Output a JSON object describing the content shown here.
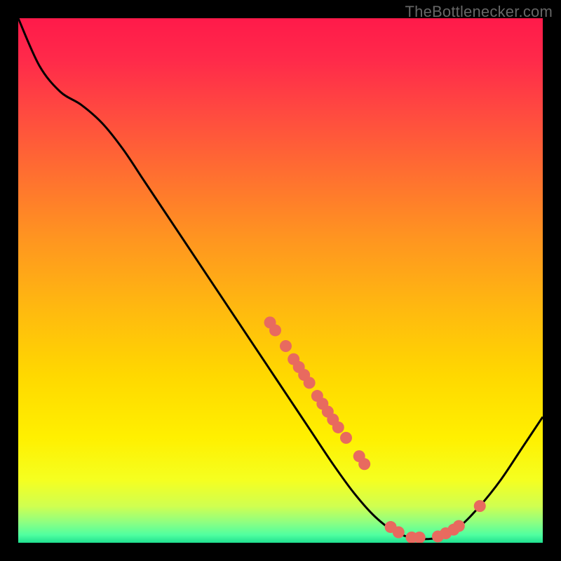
{
  "attribution": "TheBottlenecker.com",
  "chart_data": {
    "type": "line",
    "title": "",
    "xlabel": "",
    "ylabel": "",
    "xlim": [
      0,
      100
    ],
    "ylim": [
      0,
      100
    ],
    "curve": [
      {
        "x": 0.0,
        "y": 100.0
      },
      {
        "x": 4.0,
        "y": 91.0
      },
      {
        "x": 8.0,
        "y": 86.0
      },
      {
        "x": 12.0,
        "y": 83.5
      },
      {
        "x": 16.0,
        "y": 80.0
      },
      {
        "x": 20.0,
        "y": 75.0
      },
      {
        "x": 24.0,
        "y": 69.0
      },
      {
        "x": 28.0,
        "y": 63.0
      },
      {
        "x": 32.0,
        "y": 57.0
      },
      {
        "x": 36.0,
        "y": 51.0
      },
      {
        "x": 40.0,
        "y": 45.0
      },
      {
        "x": 44.0,
        "y": 39.0
      },
      {
        "x": 48.0,
        "y": 33.0
      },
      {
        "x": 52.0,
        "y": 27.0
      },
      {
        "x": 56.0,
        "y": 21.0
      },
      {
        "x": 60.0,
        "y": 15.0
      },
      {
        "x": 64.0,
        "y": 9.5
      },
      {
        "x": 68.0,
        "y": 5.0
      },
      {
        "x": 72.0,
        "y": 2.0
      },
      {
        "x": 76.0,
        "y": 0.8
      },
      {
        "x": 80.0,
        "y": 1.0
      },
      {
        "x": 84.0,
        "y": 3.0
      },
      {
        "x": 88.0,
        "y": 7.0
      },
      {
        "x": 92.0,
        "y": 12.0
      },
      {
        "x": 96.0,
        "y": 18.0
      },
      {
        "x": 100.0,
        "y": 24.0
      }
    ],
    "markers": [
      {
        "x": 48.0,
        "y": 42.0
      },
      {
        "x": 49.0,
        "y": 40.5
      },
      {
        "x": 51.0,
        "y": 37.5
      },
      {
        "x": 52.5,
        "y": 35.0
      },
      {
        "x": 53.5,
        "y": 33.5
      },
      {
        "x": 54.5,
        "y": 32.0
      },
      {
        "x": 55.5,
        "y": 30.5
      },
      {
        "x": 57.0,
        "y": 28.0
      },
      {
        "x": 58.0,
        "y": 26.5
      },
      {
        "x": 59.0,
        "y": 25.0
      },
      {
        "x": 60.0,
        "y": 23.5
      },
      {
        "x": 61.0,
        "y": 22.0
      },
      {
        "x": 62.5,
        "y": 20.0
      },
      {
        "x": 65.0,
        "y": 16.5
      },
      {
        "x": 66.0,
        "y": 15.0
      },
      {
        "x": 71.0,
        "y": 3.0
      },
      {
        "x": 72.5,
        "y": 2.0
      },
      {
        "x": 75.0,
        "y": 1.0
      },
      {
        "x": 76.5,
        "y": 1.0
      },
      {
        "x": 80.0,
        "y": 1.2
      },
      {
        "x": 81.5,
        "y": 1.8
      },
      {
        "x": 83.0,
        "y": 2.5
      },
      {
        "x": 84.0,
        "y": 3.2
      },
      {
        "x": 88.0,
        "y": 7.0
      }
    ],
    "gradient_stops": [
      {
        "offset": 0.0,
        "color": "#ff1a4a"
      },
      {
        "offset": 0.08,
        "color": "#ff2a4a"
      },
      {
        "offset": 0.18,
        "color": "#ff4a40"
      },
      {
        "offset": 0.3,
        "color": "#ff7030"
      },
      {
        "offset": 0.42,
        "color": "#ff9520"
      },
      {
        "offset": 0.55,
        "color": "#ffb810"
      },
      {
        "offset": 0.68,
        "color": "#ffd800"
      },
      {
        "offset": 0.8,
        "color": "#fff000"
      },
      {
        "offset": 0.88,
        "color": "#f5ff20"
      },
      {
        "offset": 0.93,
        "color": "#d0ff50"
      },
      {
        "offset": 0.96,
        "color": "#90ff80"
      },
      {
        "offset": 0.985,
        "color": "#50ffa0"
      },
      {
        "offset": 1.0,
        "color": "#20e090"
      }
    ],
    "marker_color": "#e86a5f",
    "curve_color": "#000000"
  }
}
